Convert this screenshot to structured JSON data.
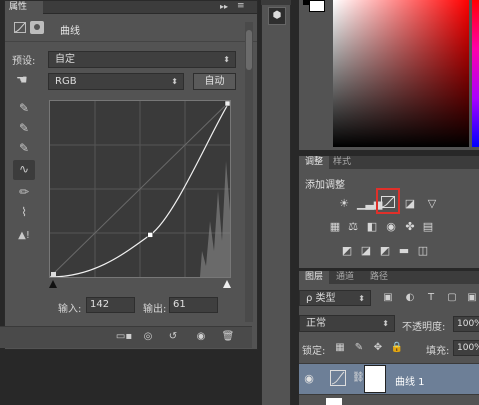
{
  "properties_panel": {
    "tab_label": "属性",
    "collapse_glyph": "▸▸",
    "menu_glyph": "≡",
    "title": "曲线",
    "preset_label": "预设:",
    "preset_value": "自定",
    "channel_value": "RGB",
    "auto_label": "自动",
    "input_label": "输入:",
    "input_value": "142",
    "output_label": "输出:",
    "output_value": "61",
    "curve_point": {
      "input": 142,
      "output": 61
    },
    "curve_range": [
      0,
      255
    ]
  },
  "adjustments_panel": {
    "tabs": [
      "调整",
      "样式"
    ],
    "title": "添加调整",
    "row1_icons": [
      "brightness-icon",
      "levels-icon",
      "curves-icon",
      "exposure-icon",
      "vibrance-icon"
    ],
    "row2_icons": [
      "hue-saturation-icon",
      "color-balance-icon",
      "black-white-icon",
      "photo-filter-icon",
      "channel-mixer-icon",
      "color-lookup-icon"
    ],
    "row3_icons": [
      "invert-icon",
      "posterize-icon",
      "threshold-icon",
      "gradient-map-icon",
      "selective-color-icon"
    ],
    "highlighted": "curves-icon"
  },
  "layers_panel": {
    "tabs": [
      "图层",
      "通道",
      "路径"
    ],
    "kind_label": "ρ 类型",
    "blend_mode": "正常",
    "opacity_label": "不透明度:",
    "opacity_value": "100%",
    "lock_label": "锁定:",
    "fill_label": "填充:",
    "fill_value": "100%",
    "layer_name": "曲线 1"
  },
  "colors": {
    "panel_bg": "#535353",
    "selected_layer": "#6d7f97",
    "highlight_box": "#e0302a"
  }
}
